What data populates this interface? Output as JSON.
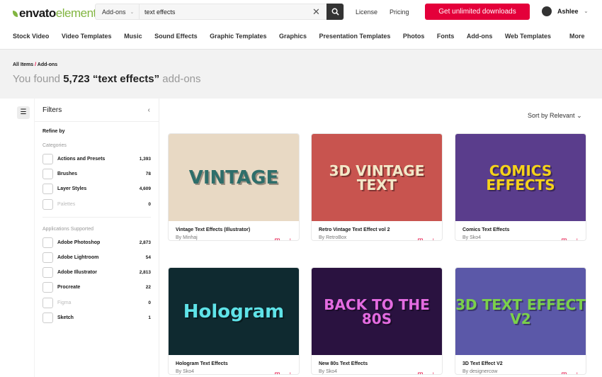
{
  "header": {
    "logo_a": "envato",
    "logo_b": "elements",
    "search_category": "Add-ons",
    "search_value": "text effects",
    "links": [
      "License",
      "Pricing"
    ],
    "cta": "Get unlimited downloads",
    "user": "Ashlee"
  },
  "nav": [
    "Stock Video",
    "Video Templates",
    "Music",
    "Sound Effects",
    "Graphic Templates",
    "Graphics",
    "Presentation Templates",
    "Photos",
    "Fonts",
    "Add-ons",
    "Web Templates",
    "More"
  ],
  "breadcrumb": {
    "root": "All Items",
    "sep": "/",
    "current": "Add-ons"
  },
  "results": {
    "prefix": "You found",
    "count": "5,723",
    "query": "“text effects”",
    "suffix": "add-ons"
  },
  "filters": {
    "title": "Filters",
    "refine": "Refine by",
    "categories_title": "Categories",
    "categories": [
      {
        "label": "Actions and Presets",
        "count": "1,393"
      },
      {
        "label": "Brushes",
        "count": "78"
      },
      {
        "label": "Layer Styles",
        "count": "4,609"
      },
      {
        "label": "Palettes",
        "count": "0"
      }
    ],
    "apps_title": "Applications Supported",
    "apps": [
      {
        "label": "Adobe Photoshop",
        "count": "2,873"
      },
      {
        "label": "Adobe Lightroom",
        "count": "54"
      },
      {
        "label": "Adobe Illustrator",
        "count": "2,813"
      },
      {
        "label": "Procreate",
        "count": "22"
      },
      {
        "label": "Figma",
        "count": "0"
      },
      {
        "label": "Sketch",
        "count": "1"
      }
    ]
  },
  "sort": "Sort by Relevant",
  "items": [
    {
      "title": "Vintage Text Effects (Illustrator)",
      "author": "By Minhaj",
      "art": "VINTAGE",
      "bg": "#e8d9c4",
      "fg": "#2e6e6a"
    },
    {
      "title": "Retro Vintage Text Effect vol 2",
      "author": "By RetroBox",
      "art": "3D VINTAGE TEXT",
      "bg": "#c8544f",
      "fg": "#f3e8c8"
    },
    {
      "title": "Comics Text Effects",
      "author": "By Sko4",
      "art": "COMICS EFFECTS",
      "bg": "#5a3d8c",
      "fg": "#f5d21a"
    },
    {
      "title": "Hologram Text Effects",
      "author": "By Sko4",
      "art": "Hologram",
      "bg": "#0f2a30",
      "fg": "#5fe3e8"
    },
    {
      "title": "New 80s Text Effects",
      "author": "By Sko4",
      "art": "BACK TO THE 80S",
      "bg": "#2a1240",
      "fg": "#e36be0"
    },
    {
      "title": "3D Text Effect V2",
      "author": "By designercow",
      "art": "3D TEXT EFFECT V2",
      "bg": "#5b58a8",
      "fg": "#7bd14a"
    }
  ]
}
